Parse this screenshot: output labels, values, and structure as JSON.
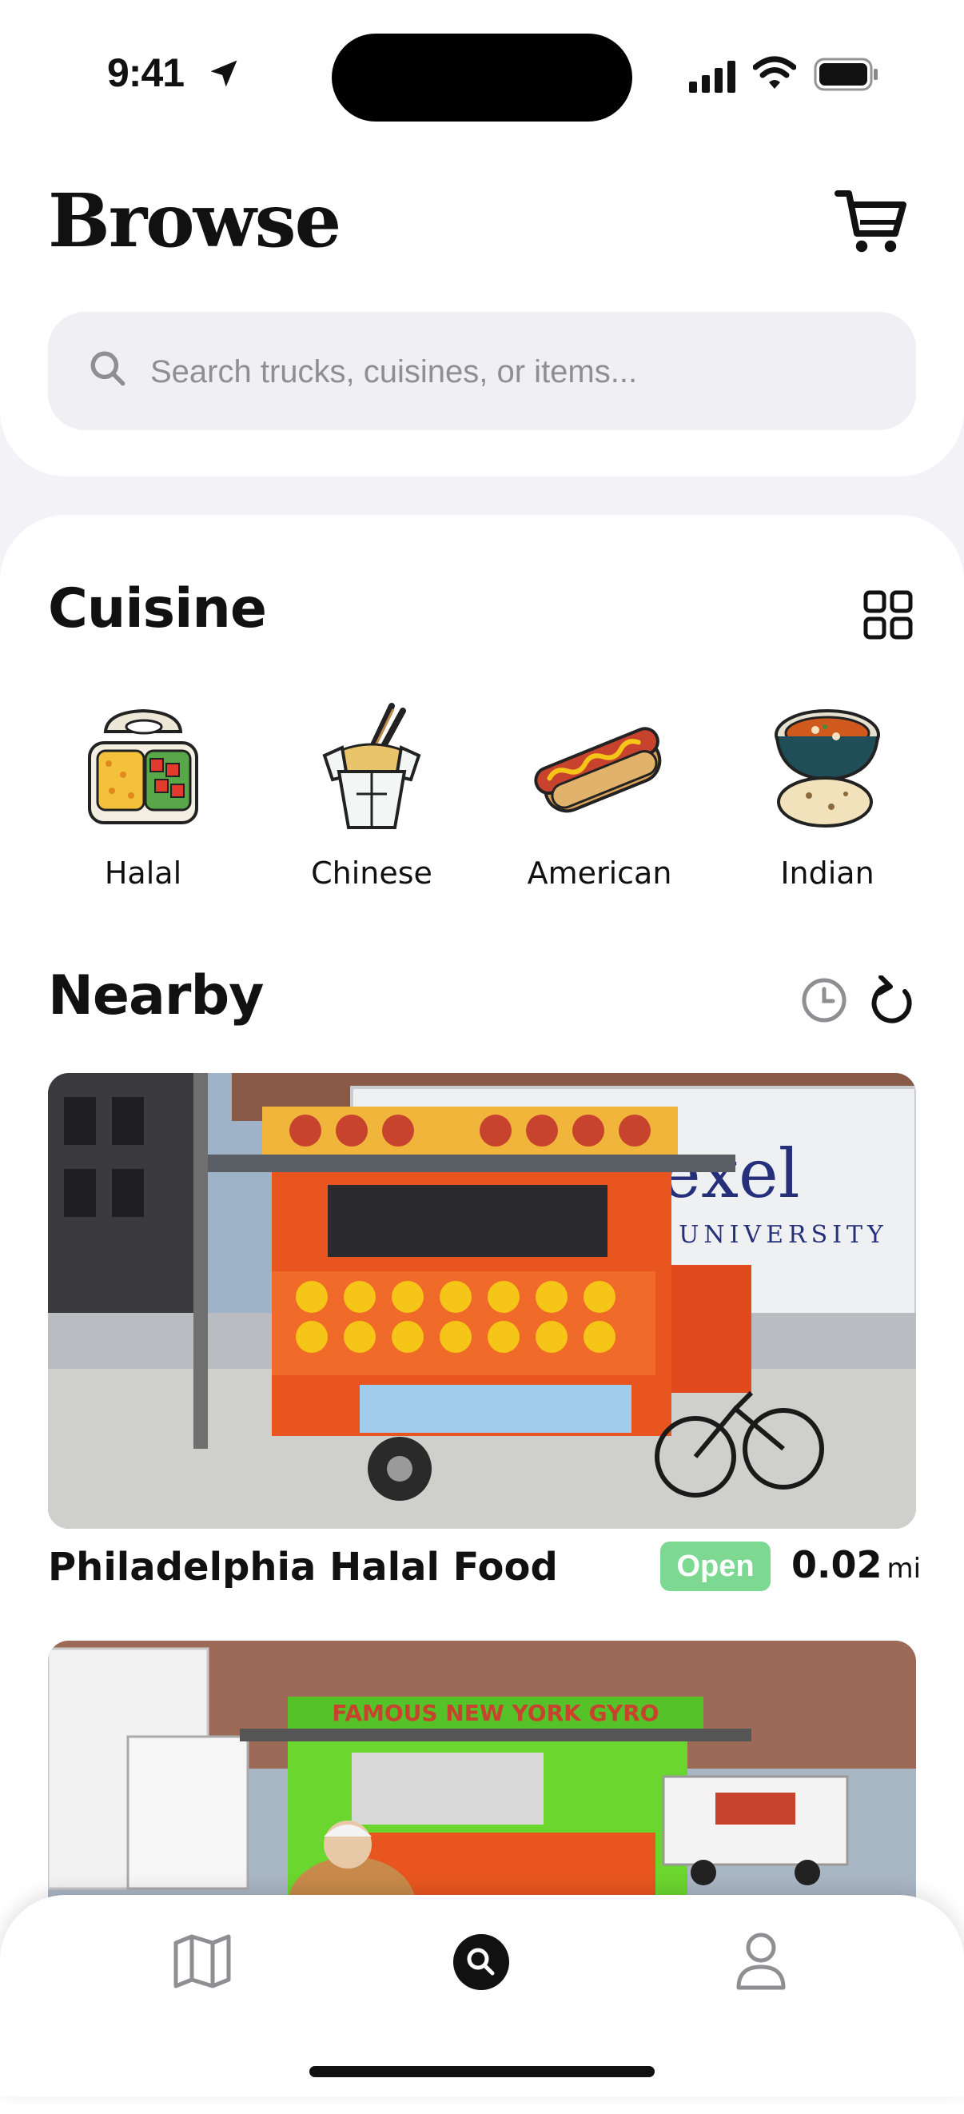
{
  "status": {
    "time": "9:41"
  },
  "header": {
    "title": "Browse",
    "search_placeholder": "Search trucks, cuisines, or items..."
  },
  "cuisine": {
    "heading": "Cuisine",
    "items": [
      {
        "label": "Halal",
        "icon": "halal-platter-icon"
      },
      {
        "label": "Chinese",
        "icon": "noodle-box-icon"
      },
      {
        "label": "American",
        "icon": "hotdog-icon"
      },
      {
        "label": "Indian",
        "icon": "curry-bowl-icon"
      }
    ]
  },
  "nearby": {
    "heading": "Nearby",
    "trucks": [
      {
        "name": "Philadelphia Halal Food",
        "status": "Open",
        "distance": "0.02",
        "unit": "mi",
        "sign_text": "Drexel",
        "sign_subtext": "UNIVERSITY"
      },
      {
        "name": "",
        "sign_text": "FAMOUS NEW YORK GYRO"
      }
    ]
  },
  "tabs": [
    {
      "icon": "map-icon"
    },
    {
      "icon": "search-icon"
    },
    {
      "icon": "profile-icon"
    }
  ],
  "colors": {
    "open_badge": "#7DD992",
    "background": "#F2F2F7",
    "search_bg": "#EFEFF4"
  }
}
